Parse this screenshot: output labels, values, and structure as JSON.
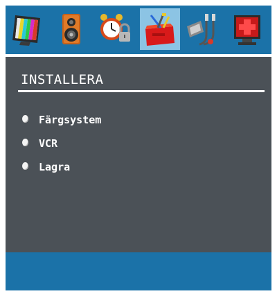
{
  "tabs": [
    {
      "icon": "tv-picture-icon",
      "selected": false
    },
    {
      "icon": "speaker-sound-icon",
      "selected": false
    },
    {
      "icon": "alarm-clock-lock-icon",
      "selected": false
    },
    {
      "icon": "toolbox-install-icon",
      "selected": true
    },
    {
      "icon": "av-cable-icon",
      "selected": false
    },
    {
      "icon": "pc-monitor-icon",
      "selected": false
    }
  ],
  "panel": {
    "title": "INSTALLERA",
    "items": [
      {
        "label": "Färgsystem"
      },
      {
        "label": "VCR"
      },
      {
        "label": "Lagra"
      }
    ]
  },
  "colors": {
    "frame": "#4b5157",
    "tabbar": "#1b72a8",
    "selected_tab": "#8cc4e4",
    "text": "#ffffff"
  }
}
